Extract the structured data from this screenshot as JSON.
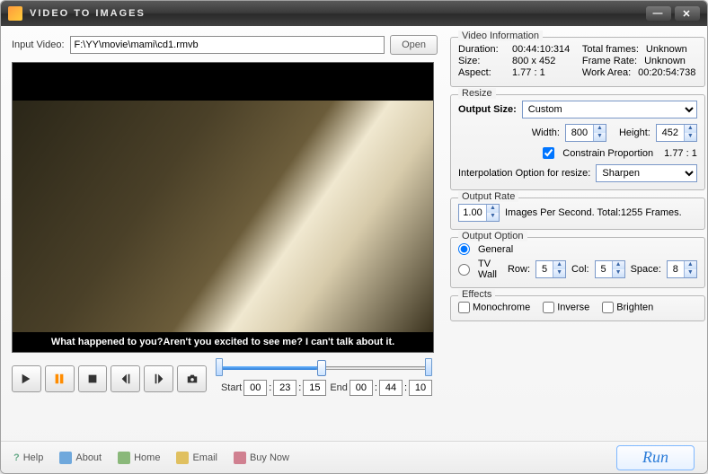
{
  "title": "Video to Images",
  "input": {
    "label": "Input Video:",
    "path": "F:\\YY\\movie\\mami\\cd1.rmvb",
    "open": "Open"
  },
  "subtitle": "What happened to you?Aren't you excited to see me? I can't talk about it.",
  "controls": {
    "start_lbl": "Start",
    "end_lbl": "End",
    "start": [
      "00",
      "23",
      "15"
    ],
    "end": [
      "00",
      "44",
      "10"
    ]
  },
  "info": {
    "legend": "Video Information",
    "duration_k": "Duration:",
    "duration_v": "00:44:10:314",
    "size_k": "Size:",
    "size_v": "800 x 452",
    "aspect_k": "Aspect:",
    "aspect_v": "1.77 : 1",
    "frames_k": "Total frames:",
    "frames_v": "Unknown",
    "rate_k": "Frame Rate:",
    "rate_v": "Unknown",
    "work_k": "Work Area:",
    "work_v": "00:20:54:738"
  },
  "resize": {
    "legend": "Resize",
    "output_lbl": "Output Size:",
    "output_sel": "Custom",
    "width_lbl": "Width:",
    "width": "800",
    "height_lbl": "Height:",
    "height": "452",
    "constrain": "Constrain Proportion",
    "constrain_ratio": "1.77 : 1",
    "interp_lbl": "Interpolation Option for resize:",
    "interp_sel": "Sharpen"
  },
  "rate": {
    "legend": "Output Rate",
    "val": "1.00",
    "tail": "Images Per Second. Total:1255 Frames."
  },
  "option": {
    "legend": "Output Option",
    "general": "General",
    "tvwall": "TV Wall",
    "row_lbl": "Row:",
    "row": "5",
    "col_lbl": "Col:",
    "col": "5",
    "space_lbl": "Space:",
    "space": "8"
  },
  "effects": {
    "legend": "Effects",
    "mono": "Monochrome",
    "inv": "Inverse",
    "bri": "Brighten"
  },
  "footer": {
    "help": "Help",
    "about": "About",
    "home": "Home",
    "email": "Email",
    "buy": "Buy Now",
    "run": "Run"
  }
}
